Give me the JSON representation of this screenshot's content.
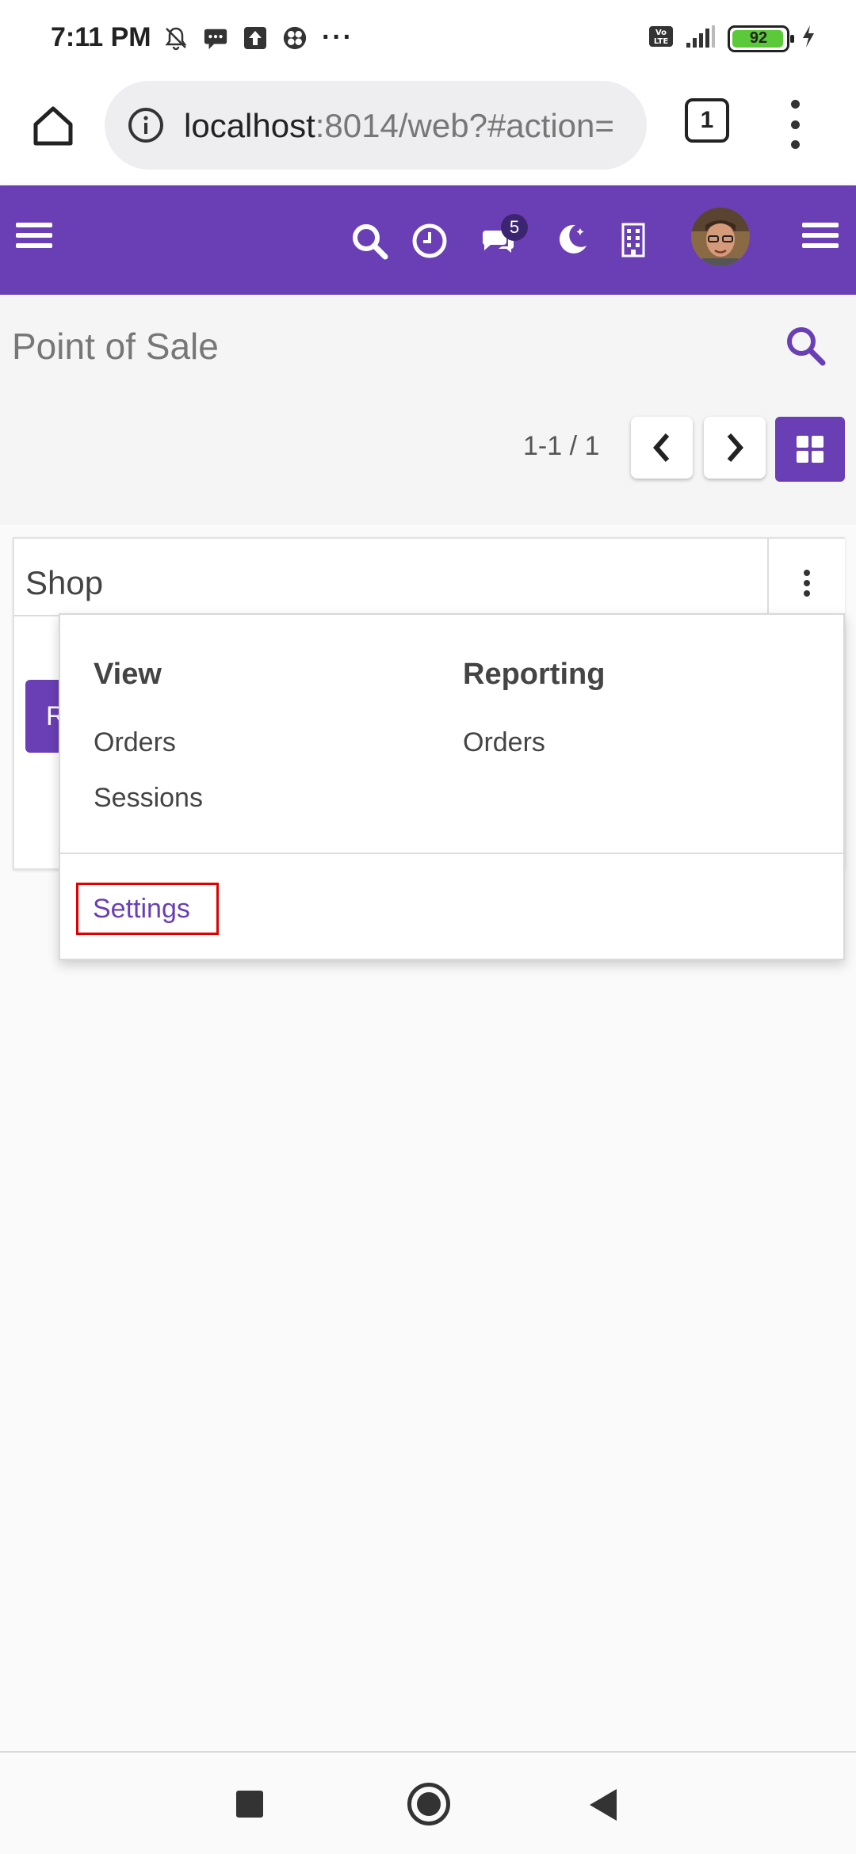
{
  "status_bar": {
    "time": "7:11 PM",
    "overflow": "···",
    "left_icons": [
      "muted-bell-icon",
      "message-icon",
      "upload-icon",
      "app-icon"
    ],
    "right_icons": [
      "volte-icon",
      "signal-icon"
    ],
    "battery_level": "92",
    "battery_color": "#5cc93a"
  },
  "browser": {
    "url_host": "localhost",
    "url_rest": ":8014/web?#action=",
    "tab_count": "1"
  },
  "app_nav": {
    "color": "#6a3fb5",
    "chat_badge": "5",
    "icons": [
      "menu-icon",
      "search-icon",
      "clock-icon",
      "chat-icon",
      "moon-icon",
      "building-icon",
      "avatar",
      "menu-icon"
    ]
  },
  "control_panel": {
    "title": "Point of Sale",
    "pager_value": "1-1 / 1"
  },
  "card": {
    "title": "Shop",
    "primary_button_label": "R"
  },
  "dropdown": {
    "view_heading": "View",
    "view_items": [
      "Orders",
      "Sessions"
    ],
    "reporting_heading": "Reporting",
    "reporting_items": [
      "Orders"
    ],
    "settings_label": "Settings"
  }
}
